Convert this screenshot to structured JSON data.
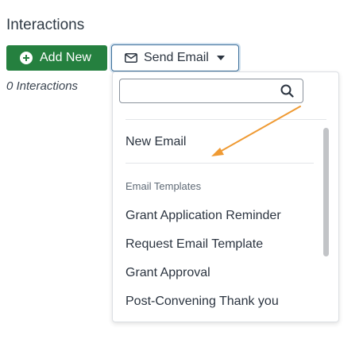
{
  "section": {
    "title": "Interactions"
  },
  "toolbar": {
    "add_label": "Add New",
    "send_email_label": "Send Email"
  },
  "count": {
    "text": "0 Interactions"
  },
  "dropdown": {
    "search": {
      "value": "",
      "placeholder": ""
    },
    "new_email_label": "New Email",
    "templates_header": "Email Templates",
    "templates": [
      {
        "label": "Grant Application Reminder"
      },
      {
        "label": "Request Email Template"
      },
      {
        "label": "Grant Approval"
      },
      {
        "label": "Post-Convening Thank you"
      }
    ]
  },
  "colors": {
    "primary_green": "#25803f",
    "focus_blue": "#3c6f9a",
    "annotation_arrow": "#ef9a33"
  },
  "icons": [
    "plus-circle-icon",
    "envelope-icon",
    "caret-down-icon",
    "search-icon"
  ]
}
